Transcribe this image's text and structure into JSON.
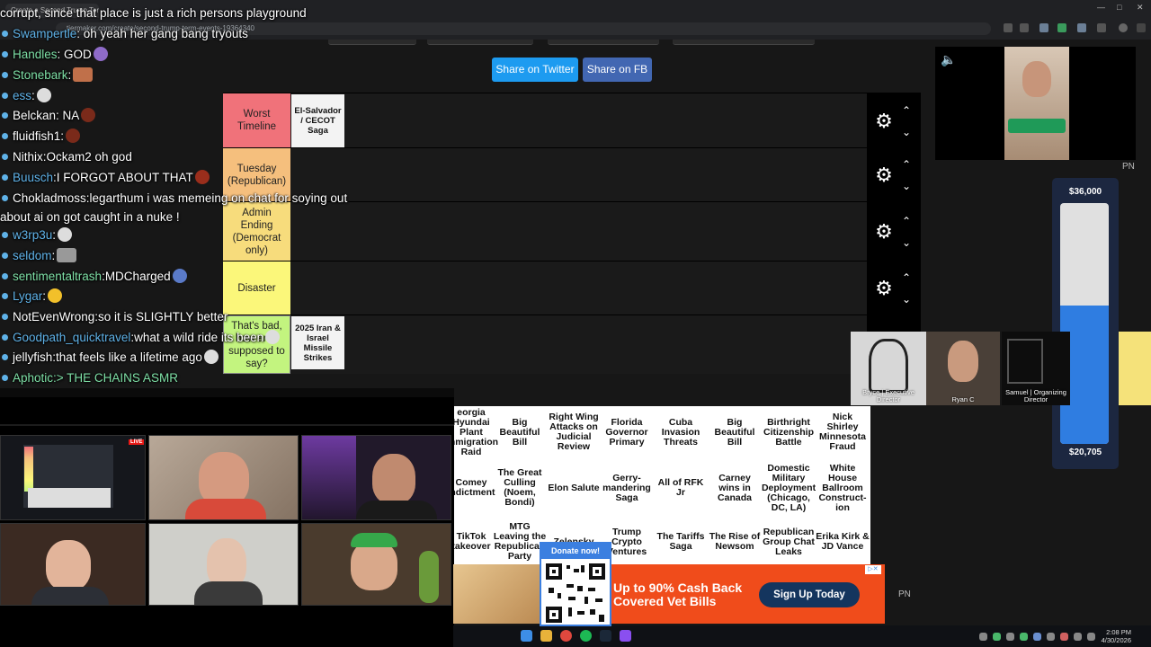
{
  "browser": {
    "tab_title": "Create a Second Trump Term Events",
    "url": "tiermaker.com/create/second-trump-term-events-19364340"
  },
  "chat": [
    {
      "user": "",
      "text": "corrupt, since that place is just a rich persons playground",
      "user_color": "#ffffff",
      "text_color": "#ffffff"
    },
    {
      "user": "Swampertle",
      "text": ": oh yeah her gang bang tryouts",
      "user_color": "#5fb2e8",
      "text_color": "#ffffff"
    },
    {
      "user": "Handles",
      "text": ": GOD",
      "user_color": "#7ee0a6",
      "text_color": "#ffffff"
    },
    {
      "user": "Stonebark",
      "text": ":",
      "user_color": "#7ee0a6",
      "text_color": "#ffffff"
    },
    {
      "user": "ess",
      "text": ":",
      "user_color": "#5fb2e8",
      "text_color": "#ffffff"
    },
    {
      "user": "Belckan",
      "text": ": NA",
      "user_color": "#ffffff",
      "text_color": "#ffffff"
    },
    {
      "user": "fluidfish1",
      "text": ":",
      "user_color": "#ffffff",
      "text_color": "#ffffff"
    },
    {
      "user": "Nithix",
      "text": ":Ockam2  oh god",
      "user_color": "#ffffff",
      "text_color": "#ffffff"
    },
    {
      "user": "Buusch",
      "text": ":I FORGOT ABOUT THAT",
      "user_color": "#5fb2e8",
      "text_color": "#ffffff"
    },
    {
      "user": "Chokladmoss",
      "text": ":legarthum i was memeing on chat for soying out about ai on got caught in a nuke  !",
      "user_color": "#ffffff",
      "text_color": "#ffffff"
    },
    {
      "user": "w3rp3u",
      "text": ":",
      "user_color": "#5fb2e8",
      "text_color": "#ffffff"
    },
    {
      "user": "seldom",
      "text": ":",
      "user_color": "#5fb2e8",
      "text_color": "#ffffff"
    },
    {
      "user": "sentimentaltrash",
      "text": ":MDCharged",
      "user_color": "#7ee0a6",
      "text_color": "#ffffff"
    },
    {
      "user": "Lygar",
      "text": ":",
      "user_color": "#5fb2e8",
      "text_color": "#ffffff"
    },
    {
      "user": "NotEvenWrong",
      "text": ":so it is SLIGHTLY better",
      "user_color": "#ffffff",
      "text_color": "#ffffff"
    },
    {
      "user": "Goodpath_quicktravel",
      "text": ":what a wild ride its been",
      "user_color": "#5fb2e8",
      "text_color": "#ffffff"
    },
    {
      "user": "jellyfish",
      "text": ":that feels like a lifetime ago",
      "user_color": "#ffffff",
      "text_color": "#ffffff"
    },
    {
      "user": "Aphotic",
      "text": ":> THE CHAINS ASMR",
      "user_color": "#7ee0a6",
      "text_color": "#7ee0a6"
    }
  ],
  "share": {
    "twitter": "Share on Twitter",
    "facebook": "Share on FB"
  },
  "tiers": [
    {
      "label": "Worst Timeline",
      "color": "#f0727a",
      "item": "El-Salvador / CECOT Saga"
    },
    {
      "label": "Tuesday (Republican)",
      "color": "#f5bf7d",
      "item": ""
    },
    {
      "label": "Admin Ending (Democrat only)",
      "color": "#f7dc7c",
      "item": ""
    },
    {
      "label": "Disaster",
      "color": "#fbf77a",
      "item": ""
    },
    {
      "label": "That's bad, how am I supposed to say?",
      "color": "#c3f47f",
      "item": "2025 Iran & Israel Missile Strikes"
    }
  ],
  "pool": [
    [
      "eorgia Hyundai Plant Immigration Raid",
      "Big Beautiful Bill",
      "Right Wing Attacks on Judicial Review",
      "Florida Governor Primary",
      "Cuba Invasion Threats",
      "Big Beautiful Bill",
      "Birthright Citizenship Battle",
      "Nick Shirley Minnesota Fraud"
    ],
    [
      "Comey Indictment",
      "The Great Culling (Noem, Bondi)",
      "Elon Salute",
      "Gerry-mandering Saga",
      "All of RFK Jr",
      "Carney wins in Canada",
      "Domestic Military Deployment (Chicago, DC, LA)",
      "White House Ballroom Construct-ion"
    ],
    [
      "TikTok takeover",
      "MTG Leaving the Republican Party",
      "Zelensky",
      "Trump Crypto Ventures",
      "The Tariffs Saga",
      "The Rise of Newsom",
      "Republican Group Chat Leaks",
      "Erika Kirk & JD Vance"
    ]
  ],
  "donation_goal": {
    "top": "$36,000",
    "bottom": "$20,705",
    "progress": 0.575
  },
  "cams": [
    "Bryce | Executive Director",
    "Ryan C",
    "Samuel | Organizing Director"
  ],
  "ad": {
    "text_line1": "Up to 90% Cash Back",
    "text_line2": "Covered Vet Bills",
    "cta": "Sign Up Today",
    "qr_label": "Donate now!"
  },
  "live_badge": "LIVE",
  "pn": "PN",
  "clock": {
    "time": "2:08 PM",
    "date": "4/30/2026"
  }
}
